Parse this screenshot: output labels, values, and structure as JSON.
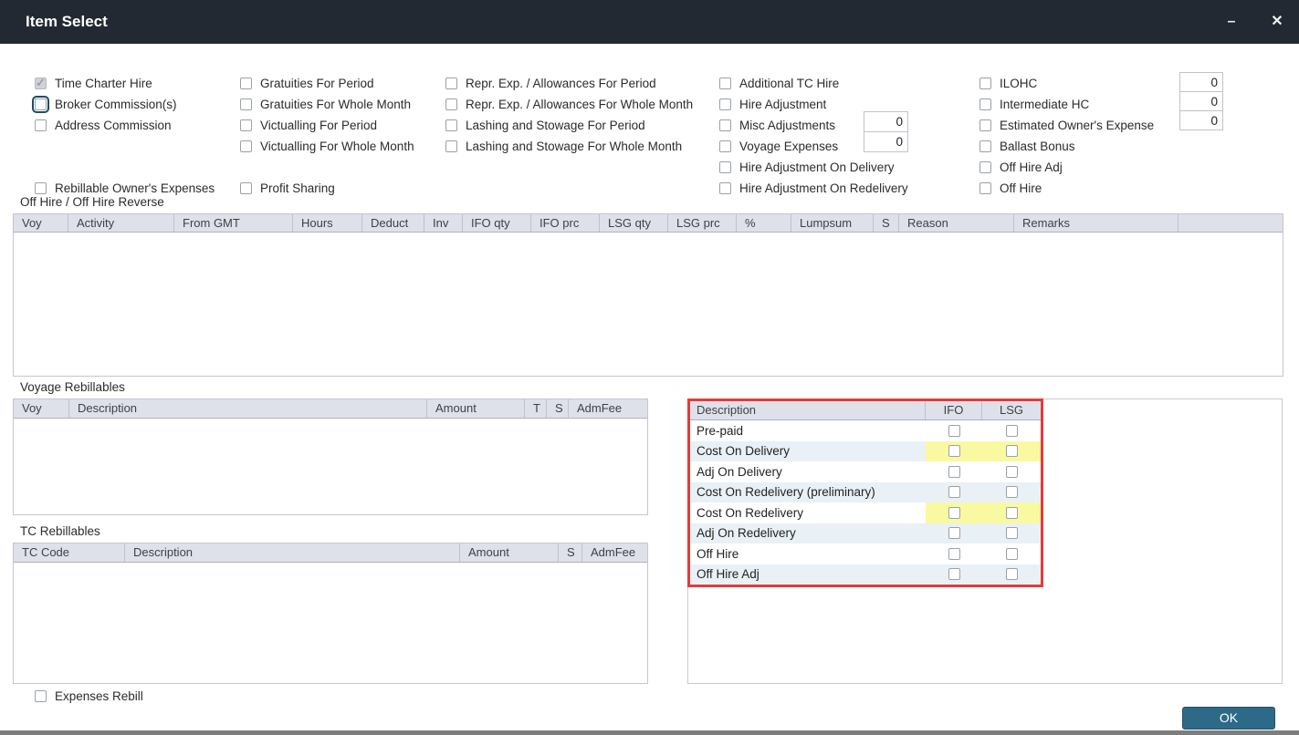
{
  "window": {
    "title": "Item Select",
    "minimize_glyph": "–",
    "close_glyph": "✕"
  },
  "checkbox_columns": [
    {
      "items": [
        {
          "label": "Time Charter Hire",
          "checked": true,
          "disabled": true
        },
        {
          "label": "Broker Commission(s)",
          "checked": false,
          "focused": true
        },
        {
          "label": "Address Commission",
          "checked": false
        }
      ]
    },
    {
      "items": [
        {
          "label": "Gratuities For Period",
          "checked": false
        },
        {
          "label": "Gratuities For Whole Month",
          "checked": false
        },
        {
          "label": "Victualling For Period",
          "checked": false
        },
        {
          "label": "Victualling For Whole Month",
          "checked": false
        }
      ]
    },
    {
      "items": [
        {
          "label": "Repr. Exp. / Allowances For Period",
          "checked": false
        },
        {
          "label": "Repr. Exp. / Allowances For Whole Month",
          "checked": false
        },
        {
          "label": "Lashing and Stowage For Period",
          "checked": false
        },
        {
          "label": "Lashing and Stowage For Whole Month",
          "checked": false
        }
      ]
    },
    {
      "items": [
        {
          "label": "Additional TC Hire",
          "checked": false
        },
        {
          "label": "Hire Adjustment",
          "checked": false
        },
        {
          "label": "Misc Adjustments",
          "checked": false
        },
        {
          "label": "Voyage Expenses",
          "checked": false
        },
        {
          "label": "Hire Adjustment On Delivery",
          "checked": false
        },
        {
          "label": "Hire Adjustment On Redelivery",
          "checked": false
        }
      ]
    },
    {
      "items": [
        {
          "label": "ILOHC",
          "checked": false
        },
        {
          "label": "Intermediate HC",
          "checked": false
        },
        {
          "label": "Estimated Owner's Expense",
          "checked": false
        },
        {
          "label": "Ballast Bonus",
          "checked": false
        },
        {
          "label": "Off Hire Adj",
          "checked": false
        },
        {
          "label": "Off Hire",
          "checked": false
        }
      ]
    }
  ],
  "extra_checkboxes": {
    "rebillable": {
      "label": "Rebillable Owner's Expenses",
      "checked": false
    },
    "profit_sharing": {
      "label": "Profit Sharing",
      "checked": false
    },
    "expenses_rebill": {
      "label": "Expenses Rebill",
      "checked": false
    }
  },
  "inputs": {
    "misc_adjustments": "0",
    "voyage_expenses": "0",
    "ilohc": "0",
    "intermediate_hc": "0",
    "estimated_owners_expense": "0"
  },
  "off_hire_section": {
    "label": "Off Hire / Off Hire Reverse",
    "columns": [
      "Voy",
      "Activity",
      "From GMT",
      "Hours",
      "Deduct",
      "Inv",
      "IFO qty",
      "IFO prc",
      "LSG qty",
      "LSG prc",
      "%",
      "Lumpsum",
      "S",
      "Reason",
      "Remarks"
    ]
  },
  "voyage_rebillables": {
    "label": "Voyage Rebillables",
    "columns": [
      "Voy",
      "Description",
      "Amount",
      "T",
      "S",
      "AdmFee"
    ]
  },
  "tc_rebillables": {
    "label": "TC Rebillables",
    "columns": [
      "TC Code",
      "Description",
      "Amount",
      "S",
      "AdmFee"
    ]
  },
  "delivery_table": {
    "columns": [
      "Description",
      "IFO",
      "LSG"
    ],
    "rows": [
      {
        "label": "Pre-paid",
        "ifo_checked": false,
        "lsg_checked": false,
        "highlight": false
      },
      {
        "label": "Cost On Delivery",
        "ifo_checked": false,
        "lsg_checked": false,
        "highlight": true
      },
      {
        "label": "Adj On Delivery",
        "ifo_checked": false,
        "lsg_checked": false,
        "highlight": false
      },
      {
        "label": "Cost On Redelivery (preliminary)",
        "ifo_checked": false,
        "lsg_checked": false,
        "highlight": false
      },
      {
        "label": "Cost On Redelivery",
        "ifo_checked": false,
        "lsg_checked": false,
        "highlight": true
      },
      {
        "label": "Adj On Redelivery",
        "ifo_checked": false,
        "lsg_checked": false,
        "highlight": false
      },
      {
        "label": "Off Hire",
        "ifo_checked": false,
        "lsg_checked": false,
        "highlight": false
      },
      {
        "label": "Off Hire Adj",
        "ifo_checked": false,
        "lsg_checked": false,
        "highlight": false
      }
    ]
  },
  "ok_button": {
    "label": "OK"
  },
  "colors": {
    "titlebar": "#232932",
    "table_header_bg": "#dee1ea",
    "row_alt_blue": "#e9f1f6",
    "highlight_yellow": "#f9f9a2",
    "red_border": "#e23b3b",
    "ok_button_bg": "#2d6a87",
    "focus_ring": "#1d4e63"
  }
}
